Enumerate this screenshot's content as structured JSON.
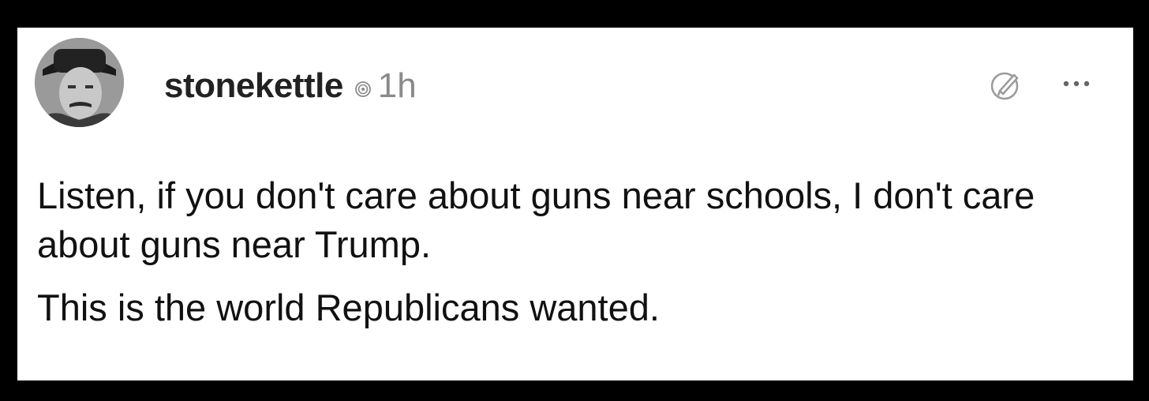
{
  "post": {
    "username": "stonekettle",
    "timestamp": "1h",
    "paragraphs": [
      "Listen, if you don't care about guns near schools, I don't care about guns near Trump.",
      "This is the world Republicans wanted."
    ]
  },
  "icons": {
    "avatar": "profile-photo",
    "verified": "threads-icon",
    "edit": "edit-pencil-icon",
    "more": "more-options-icon"
  },
  "colors": {
    "background": "#000000",
    "card": "#ffffff",
    "username": "#222222",
    "timestamp": "#8a8a8a",
    "body_text": "#111111"
  }
}
